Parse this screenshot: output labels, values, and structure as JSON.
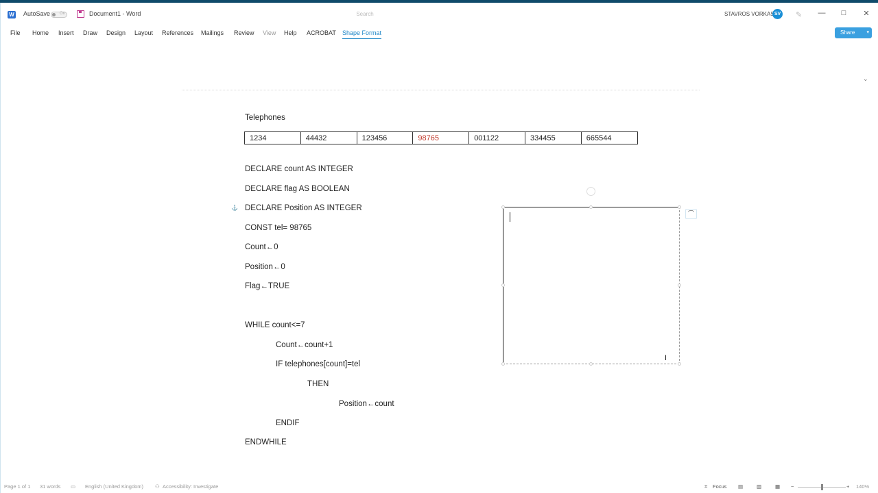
{
  "titlebar": {
    "autosave_label": "AutoSave",
    "autosave_state": "On",
    "document_title": "Document1  -  Word",
    "search_placeholder": "Search",
    "user_name": "STAVROS VORKAS",
    "user_initials": "SV",
    "minimize": "—",
    "maximize": "□",
    "close": "✕"
  },
  "ribbon": {
    "tabs": [
      "File",
      "Home",
      "Insert",
      "Draw",
      "Design",
      "Layout",
      "References",
      "Mailings",
      "Review",
      "View",
      "Help",
      "ACROBAT",
      "Shape Format"
    ],
    "active_tab": "Shape Format",
    "share_label": "Share"
  },
  "document": {
    "heading": "Telephones",
    "table": [
      "1234",
      "44432",
      "123456",
      "98765",
      "001122",
      "334455",
      "665544"
    ],
    "highlight_value": "98765",
    "highlight_color": "#c0392b",
    "lines": [
      "DECLARE count AS INTEGER",
      "DECLARE flag AS BOOLEAN",
      "DECLARE Position AS INTEGER",
      "CONST tel= 98765",
      "Count←0",
      "Position←0",
      "Flag←TRUE",
      "WHILE count<=7",
      "Count←count+1",
      "IF telephones[count]=tel",
      "THEN",
      "Position←count",
      "ENDIF",
      "ENDWHILE"
    ]
  },
  "status": {
    "page": "Page 1 of 1",
    "words": "31 words",
    "language": "English (United Kingdom)",
    "accessibility": "Accessibility: Investigate",
    "focus": "Focus",
    "zoom": "140%"
  },
  "colors": {
    "accent": "#1d86c7",
    "share": "#3aa0e0",
    "title_bar": "#0f4a6a"
  },
  "icons": [
    "word-logo-icon",
    "save-icon",
    "avatar",
    "pen-icon",
    "rotate-icon",
    "layout-options-icon",
    "i-beam-cursor-icon",
    "focus-icon",
    "read-mode-icon",
    "print-layout-icon",
    "web-layout-icon"
  ]
}
